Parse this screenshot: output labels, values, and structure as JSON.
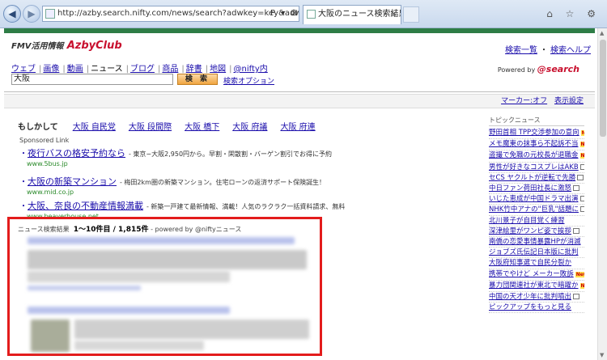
{
  "browser": {
    "address": "http://azby.search.nifty.com/news/search?adwkey=key&adwcfg=%8C%9F%8E",
    "address_tools": "P ▾ ⊠ C ✕",
    "tab_title": "大阪のニュース検索結果 -...",
    "tab_close": "×",
    "back_icon": "◀",
    "forward_icon": "▶",
    "window_icons": "⌂ ☆ ⚙"
  },
  "header": {
    "logo_prefix": "FMV活用情報",
    "logo_name": "AzbyClub",
    "links": [
      "検索一覧",
      "・",
      "検索ヘルプ"
    ]
  },
  "search": {
    "tabs": [
      "ウェブ",
      "画像",
      "動画",
      "ニュース",
      "ブログ",
      "商品",
      "辞書",
      "地図",
      "@nifty内"
    ],
    "active_tab": "ニュース",
    "query": "大阪",
    "button_label": "検 索",
    "options_link": "検索オプション",
    "powered_by": "Powered by",
    "powered_brand": "@search"
  },
  "settings": {
    "marker": "マーカー:オフ",
    "display": "表示設定"
  },
  "suggest": {
    "label": "もしかして",
    "queries": [
      "大阪 自民党",
      "大阪 段間際",
      "大阪 橋下",
      "大阪 府議",
      "大阪 府連"
    ]
  },
  "sponsored": {
    "label": "Sponsored Link",
    "ads": [
      {
        "title": "夜行バスの格安予約なら",
        "desc": "- 東京−大阪2,950円から。早割・閑散割・バーゲン割引でお得に予約",
        "url": "www.5bus.jp"
      },
      {
        "title": "大阪の新築マンション",
        "desc": "- 梅田2km圏の新築マンション。住宅ローンの返済サポート保険誕生！",
        "url": "www.mid.co.jp"
      },
      {
        "title": "大阪、奈良の不動産情報満載",
        "desc": "- 新築一戸建て最新情報、満載！人気のラクラク一括資料請求、無料",
        "url": "www.beaverhouse.net"
      }
    ]
  },
  "news": {
    "label": "ニュース検索結果",
    "range": "1〜10件目 / 1,815件",
    "powered": "- powered by @niftyニュース"
  },
  "topics": {
    "header": "トピックニュース",
    "items": [
      {
        "text": "野田首相 TPP交渉参加の意向",
        "badge": "New"
      },
      {
        "text": "メモ魔東の抹事ら不起訴不当",
        "badge": "New"
      },
      {
        "text": "盗撮で免職の元校長が退職金",
        "badge": "New"
      },
      {
        "text": "男性が好きなコスプレはAKB",
        "badge": "img"
      },
      {
        "text": "セCS ヤクルトが逆転で先勝",
        "badge": "img"
      },
      {
        "text": "中日ファン荷田社長に激怒",
        "badge": "img"
      },
      {
        "text": "いじた恵成が中国ドラマ出演",
        "badge": "img"
      },
      {
        "text": "NHK竹中アナの\"巨乳\"話題に",
        "badge": "img"
      },
      {
        "text": "北川景子が自目覚く練習",
        "badge": ""
      },
      {
        "text": "深津絵里がワンピ姿で挨拶",
        "badge": "img"
      },
      {
        "text": "南僑の恋愛事情暴露HPが消滅",
        "badge": ""
      },
      {
        "text": "ジョブズ氏伝記日本版に批判",
        "badge": ""
      },
      {
        "text": "大阪府知事選で自民分裂か",
        "badge": ""
      },
      {
        "text": "携帯でやけど メーカー敗訴",
        "badge": "New"
      },
      {
        "text": "暴力団関連社が東北で暗躍か",
        "badge": "New"
      },
      {
        "text": "中国の天才少年に批判噴出",
        "badge": "img"
      },
      {
        "text": "ピックアップをもっと見る",
        "badge": ""
      }
    ]
  }
}
